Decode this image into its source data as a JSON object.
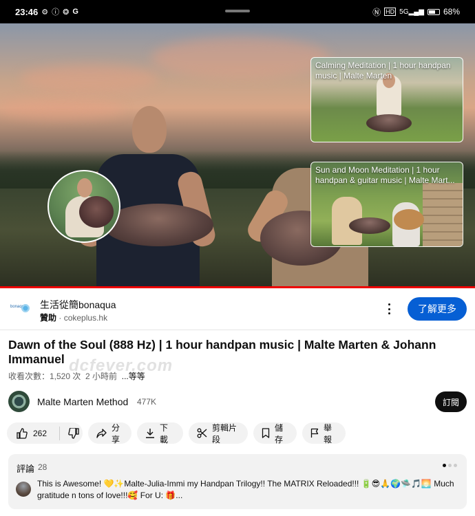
{
  "status_bar": {
    "time": "23:46",
    "left_icons": [
      "gear-icon",
      "info-icon",
      "settings-icon",
      "google-icon"
    ],
    "right_icons": [
      "nfc-icon",
      "hd-icon",
      "5g-signal-icon"
    ],
    "signal_label": "5G",
    "battery": "68%",
    "battery_level": 0.68
  },
  "video": {
    "progress_color": "#ee0000",
    "end_cards": [
      {
        "title": "Calming Meditation | 1 hour handpan music | Malte Marten"
      },
      {
        "title": "Sun and Moon Meditation | 1 hour handpan & guitar music | Malte Mart..."
      }
    ]
  },
  "ad": {
    "logo_text": "bonaqua",
    "name": "生活從簡bonaqua",
    "sponsored": "贊助",
    "separator": "·",
    "domain": "cokeplus.hk",
    "cta": "了解更多",
    "cta_color": "#065fd4"
  },
  "video_info": {
    "title": "Dawn of the Soul (888 Hz) | 1 hour handpan music | Malte Marten & Johann Immanuel",
    "views": "收看次數：1,520 次",
    "time_ago": "2 小時前",
    "more": "...等等"
  },
  "channel": {
    "name": "Malte Marten Method",
    "subscribers": "477K",
    "subscribe": "訂閱"
  },
  "actions": {
    "likes": "262",
    "share": "分享",
    "download": "下載",
    "clip": "剪輯片段",
    "save": "儲存",
    "report": "舉報"
  },
  "comments": {
    "title": "評論",
    "count": "28",
    "top_comment": "This is Awesome! 💛✨Malte-Julia-Immi my Handpan Trilogy!! The MATRIX Reloaded!!! 🔋😎🙏🌍🛸🎵🌅 Much gratitude n tons of love!!!🥰 For U: 🎁..."
  },
  "watermark": "dcfever.com"
}
